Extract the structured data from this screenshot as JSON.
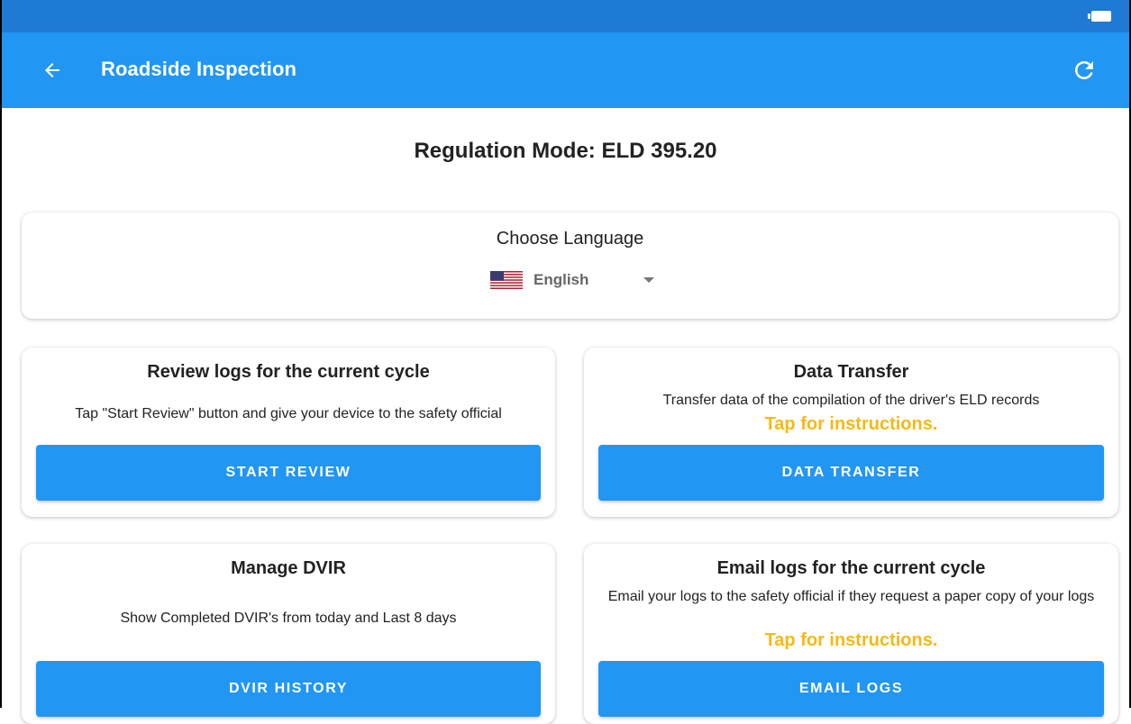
{
  "colors": {
    "status_bar": "#1e7ad4",
    "app_bar": "#2196f3",
    "button": "#2196f3",
    "tap_link": "#f6b915"
  },
  "appbar": {
    "title": "Roadside Inspection",
    "back_icon": "arrow-left-icon",
    "refresh_icon": "refresh-icon"
  },
  "regulation": {
    "label": "Regulation Mode: ELD 395.20"
  },
  "language": {
    "title": "Choose Language",
    "selected": "English",
    "flag_icon": "us-flag-icon"
  },
  "cards": {
    "review": {
      "title": "Review logs for the current cycle",
      "description": "Tap \"Start Review\" button and give your device to the safety official",
      "button": "START REVIEW"
    },
    "transfer": {
      "title": "Data Transfer",
      "description": "Transfer data of the compilation of the driver's ELD records",
      "tap": "Tap for instructions.",
      "button": "DATA TRANSFER"
    },
    "dvir": {
      "title": "Manage DVIR",
      "description": "Show Completed DVIR's from today and Last 8 days",
      "button": "DVIR HISTORY"
    },
    "email": {
      "title": "Email logs for the current cycle",
      "description": "Email your logs to the safety official if they request a paper copy of your logs",
      "tap": "Tap for instructions.",
      "button": "EMAIL LOGS"
    }
  }
}
